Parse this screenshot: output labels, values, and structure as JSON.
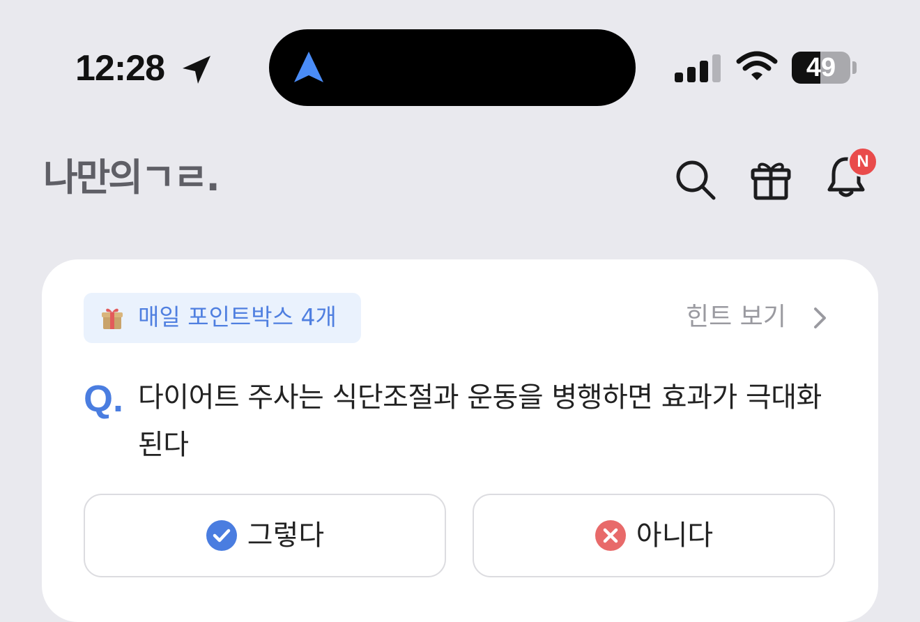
{
  "status_bar": {
    "time": "12:28",
    "battery_percent": 49,
    "battery_label": "49",
    "icons": [
      "location-arrow-icon",
      "navigation-icon",
      "signal-icon",
      "wifi-icon",
      "battery-icon"
    ],
    "island_accent": "#4a8cf7"
  },
  "header": {
    "logo_text": "나만의ㄱㄹ.",
    "icons": [
      "search-icon",
      "gift-icon",
      "bell-icon"
    ],
    "notification_badge": "N"
  },
  "card": {
    "points_badge": "매일 포인트박스 4개",
    "hint_link": "힌트 보기",
    "q_mark": "Q.",
    "question": "다이어트 주사는 식단조절과 운동을 병행하면 효과가 극대화된다",
    "answers": [
      {
        "label": "그렇다",
        "icon": "check-circle-icon",
        "color": "#4a7de0"
      },
      {
        "label": "아니다",
        "icon": "x-circle-icon",
        "color": "#e86a6a"
      }
    ]
  },
  "colors": {
    "background": "#e9e9ee",
    "accent": "#4a7de0",
    "badge_red": "#e94b4b"
  }
}
